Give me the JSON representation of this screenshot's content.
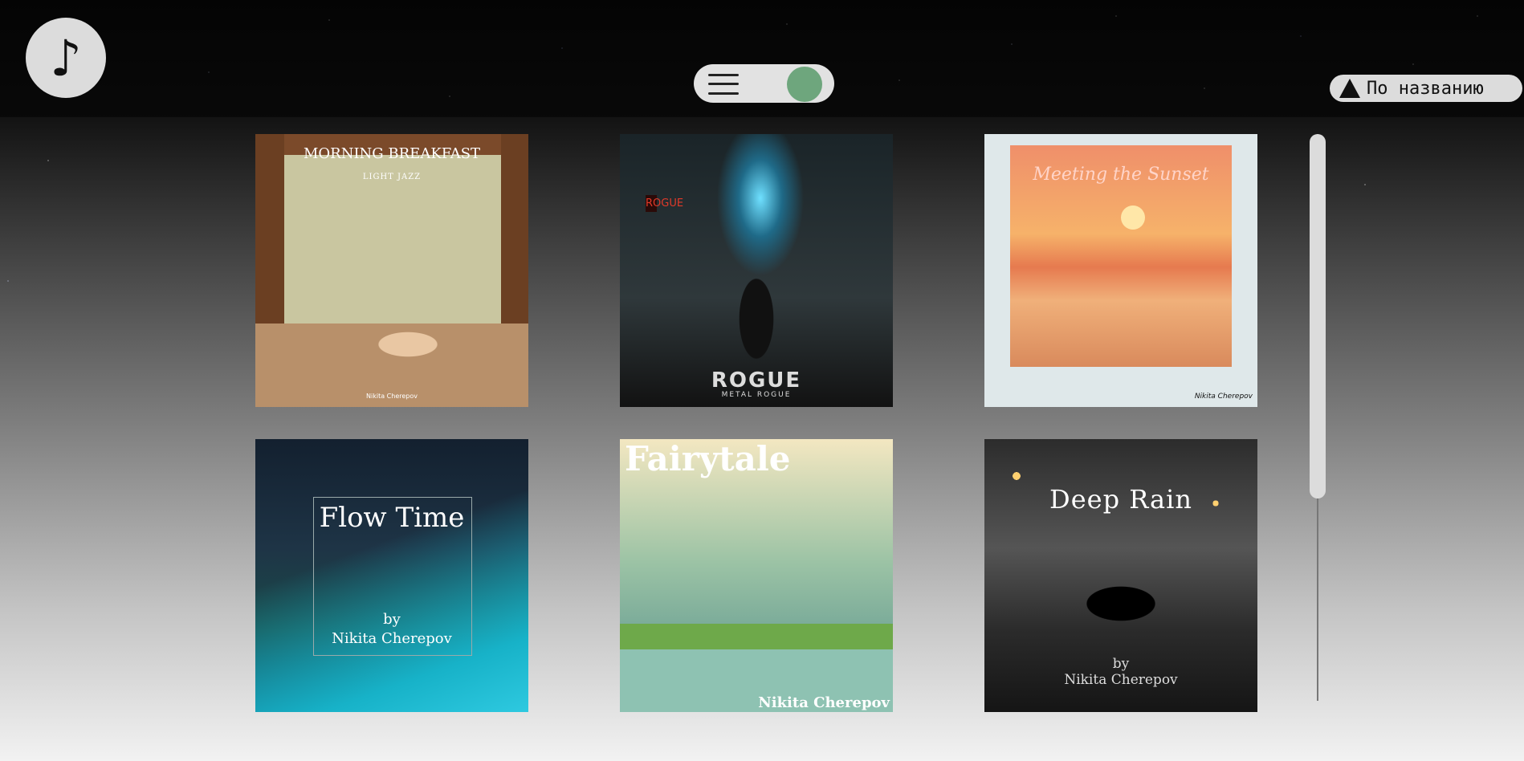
{
  "header": {
    "logo_glyph": "♪",
    "sort_label": "По названию"
  },
  "colors": {
    "toggle_knob": "#6ea67d",
    "pill_bg": "#e2e2e2"
  },
  "albums": [
    {
      "title": "MORNING BREAKFAST",
      "subtitle": "LIGHT JAZZ",
      "credit": "Nikita Cherepov"
    },
    {
      "title": "ROGUE",
      "subtitle": "METAL ROGUE",
      "side_text": "ROGUE"
    },
    {
      "title": "Meeting the Sunset",
      "credit": "Nikita Cherepov"
    },
    {
      "title": "Flow Time",
      "by": "by",
      "credit": "Nikita Cherepov"
    },
    {
      "title": "Fairytale",
      "credit": "Nikita Cherepov"
    },
    {
      "title": "Deep Rain",
      "by": "by",
      "credit": "Nikita Cherepov"
    }
  ]
}
